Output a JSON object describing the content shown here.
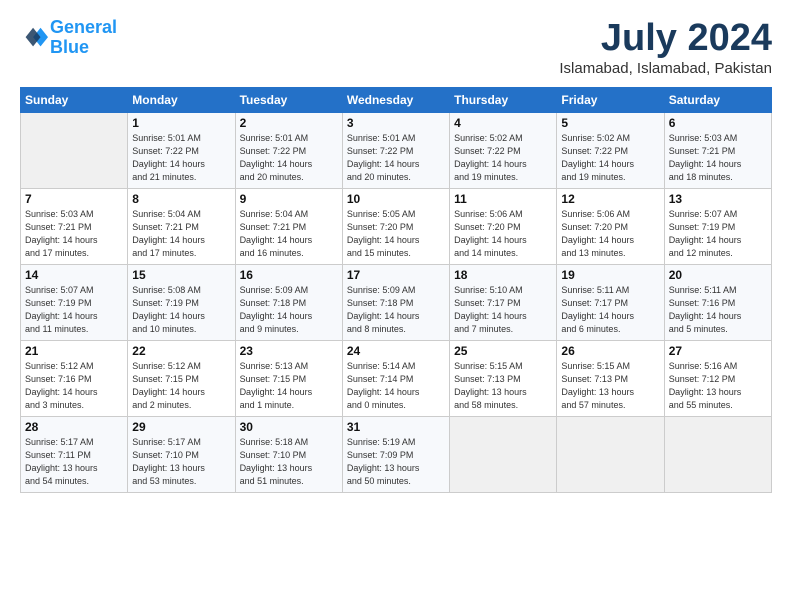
{
  "header": {
    "logo_line1": "General",
    "logo_line2": "Blue",
    "month": "July 2024",
    "location": "Islamabad, Islamabad, Pakistan"
  },
  "days_of_week": [
    "Sunday",
    "Monday",
    "Tuesday",
    "Wednesday",
    "Thursday",
    "Friday",
    "Saturday"
  ],
  "weeks": [
    [
      {
        "num": "",
        "detail": ""
      },
      {
        "num": "1",
        "detail": "Sunrise: 5:01 AM\nSunset: 7:22 PM\nDaylight: 14 hours\nand 21 minutes."
      },
      {
        "num": "2",
        "detail": "Sunrise: 5:01 AM\nSunset: 7:22 PM\nDaylight: 14 hours\nand 20 minutes."
      },
      {
        "num": "3",
        "detail": "Sunrise: 5:01 AM\nSunset: 7:22 PM\nDaylight: 14 hours\nand 20 minutes."
      },
      {
        "num": "4",
        "detail": "Sunrise: 5:02 AM\nSunset: 7:22 PM\nDaylight: 14 hours\nand 19 minutes."
      },
      {
        "num": "5",
        "detail": "Sunrise: 5:02 AM\nSunset: 7:22 PM\nDaylight: 14 hours\nand 19 minutes."
      },
      {
        "num": "6",
        "detail": "Sunrise: 5:03 AM\nSunset: 7:21 PM\nDaylight: 14 hours\nand 18 minutes."
      }
    ],
    [
      {
        "num": "7",
        "detail": "Sunrise: 5:03 AM\nSunset: 7:21 PM\nDaylight: 14 hours\nand 17 minutes."
      },
      {
        "num": "8",
        "detail": "Sunrise: 5:04 AM\nSunset: 7:21 PM\nDaylight: 14 hours\nand 17 minutes."
      },
      {
        "num": "9",
        "detail": "Sunrise: 5:04 AM\nSunset: 7:21 PM\nDaylight: 14 hours\nand 16 minutes."
      },
      {
        "num": "10",
        "detail": "Sunrise: 5:05 AM\nSunset: 7:20 PM\nDaylight: 14 hours\nand 15 minutes."
      },
      {
        "num": "11",
        "detail": "Sunrise: 5:06 AM\nSunset: 7:20 PM\nDaylight: 14 hours\nand 14 minutes."
      },
      {
        "num": "12",
        "detail": "Sunrise: 5:06 AM\nSunset: 7:20 PM\nDaylight: 14 hours\nand 13 minutes."
      },
      {
        "num": "13",
        "detail": "Sunrise: 5:07 AM\nSunset: 7:19 PM\nDaylight: 14 hours\nand 12 minutes."
      }
    ],
    [
      {
        "num": "14",
        "detail": "Sunrise: 5:07 AM\nSunset: 7:19 PM\nDaylight: 14 hours\nand 11 minutes."
      },
      {
        "num": "15",
        "detail": "Sunrise: 5:08 AM\nSunset: 7:19 PM\nDaylight: 14 hours\nand 10 minutes."
      },
      {
        "num": "16",
        "detail": "Sunrise: 5:09 AM\nSunset: 7:18 PM\nDaylight: 14 hours\nand 9 minutes."
      },
      {
        "num": "17",
        "detail": "Sunrise: 5:09 AM\nSunset: 7:18 PM\nDaylight: 14 hours\nand 8 minutes."
      },
      {
        "num": "18",
        "detail": "Sunrise: 5:10 AM\nSunset: 7:17 PM\nDaylight: 14 hours\nand 7 minutes."
      },
      {
        "num": "19",
        "detail": "Sunrise: 5:11 AM\nSunset: 7:17 PM\nDaylight: 14 hours\nand 6 minutes."
      },
      {
        "num": "20",
        "detail": "Sunrise: 5:11 AM\nSunset: 7:16 PM\nDaylight: 14 hours\nand 5 minutes."
      }
    ],
    [
      {
        "num": "21",
        "detail": "Sunrise: 5:12 AM\nSunset: 7:16 PM\nDaylight: 14 hours\nand 3 minutes."
      },
      {
        "num": "22",
        "detail": "Sunrise: 5:12 AM\nSunset: 7:15 PM\nDaylight: 14 hours\nand 2 minutes."
      },
      {
        "num": "23",
        "detail": "Sunrise: 5:13 AM\nSunset: 7:15 PM\nDaylight: 14 hours\nand 1 minute."
      },
      {
        "num": "24",
        "detail": "Sunrise: 5:14 AM\nSunset: 7:14 PM\nDaylight: 14 hours\nand 0 minutes."
      },
      {
        "num": "25",
        "detail": "Sunrise: 5:15 AM\nSunset: 7:13 PM\nDaylight: 13 hours\nand 58 minutes."
      },
      {
        "num": "26",
        "detail": "Sunrise: 5:15 AM\nSunset: 7:13 PM\nDaylight: 13 hours\nand 57 minutes."
      },
      {
        "num": "27",
        "detail": "Sunrise: 5:16 AM\nSunset: 7:12 PM\nDaylight: 13 hours\nand 55 minutes."
      }
    ],
    [
      {
        "num": "28",
        "detail": "Sunrise: 5:17 AM\nSunset: 7:11 PM\nDaylight: 13 hours\nand 54 minutes."
      },
      {
        "num": "29",
        "detail": "Sunrise: 5:17 AM\nSunset: 7:10 PM\nDaylight: 13 hours\nand 53 minutes."
      },
      {
        "num": "30",
        "detail": "Sunrise: 5:18 AM\nSunset: 7:10 PM\nDaylight: 13 hours\nand 51 minutes."
      },
      {
        "num": "31",
        "detail": "Sunrise: 5:19 AM\nSunset: 7:09 PM\nDaylight: 13 hours\nand 50 minutes."
      },
      {
        "num": "",
        "detail": ""
      },
      {
        "num": "",
        "detail": ""
      },
      {
        "num": "",
        "detail": ""
      }
    ]
  ]
}
